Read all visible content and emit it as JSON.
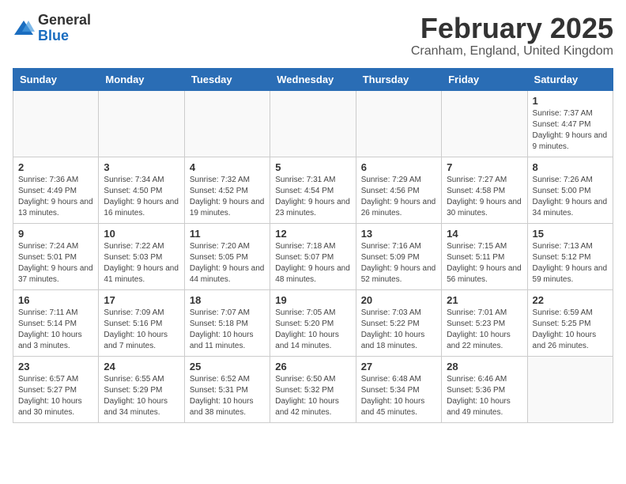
{
  "header": {
    "logo_general": "General",
    "logo_blue": "Blue",
    "month_title": "February 2025",
    "location": "Cranham, England, United Kingdom"
  },
  "weekdays": [
    "Sunday",
    "Monday",
    "Tuesday",
    "Wednesday",
    "Thursday",
    "Friday",
    "Saturday"
  ],
  "weeks": [
    [
      {
        "day": "",
        "info": ""
      },
      {
        "day": "",
        "info": ""
      },
      {
        "day": "",
        "info": ""
      },
      {
        "day": "",
        "info": ""
      },
      {
        "day": "",
        "info": ""
      },
      {
        "day": "",
        "info": ""
      },
      {
        "day": "1",
        "info": "Sunrise: 7:37 AM\nSunset: 4:47 PM\nDaylight: 9 hours\nand 9 minutes."
      }
    ],
    [
      {
        "day": "2",
        "info": "Sunrise: 7:36 AM\nSunset: 4:49 PM\nDaylight: 9 hours\nand 13 minutes."
      },
      {
        "day": "3",
        "info": "Sunrise: 7:34 AM\nSunset: 4:50 PM\nDaylight: 9 hours\nand 16 minutes."
      },
      {
        "day": "4",
        "info": "Sunrise: 7:32 AM\nSunset: 4:52 PM\nDaylight: 9 hours\nand 19 minutes."
      },
      {
        "day": "5",
        "info": "Sunrise: 7:31 AM\nSunset: 4:54 PM\nDaylight: 9 hours\nand 23 minutes."
      },
      {
        "day": "6",
        "info": "Sunrise: 7:29 AM\nSunset: 4:56 PM\nDaylight: 9 hours\nand 26 minutes."
      },
      {
        "day": "7",
        "info": "Sunrise: 7:27 AM\nSunset: 4:58 PM\nDaylight: 9 hours\nand 30 minutes."
      },
      {
        "day": "8",
        "info": "Sunrise: 7:26 AM\nSunset: 5:00 PM\nDaylight: 9 hours\nand 34 minutes."
      }
    ],
    [
      {
        "day": "9",
        "info": "Sunrise: 7:24 AM\nSunset: 5:01 PM\nDaylight: 9 hours\nand 37 minutes."
      },
      {
        "day": "10",
        "info": "Sunrise: 7:22 AM\nSunset: 5:03 PM\nDaylight: 9 hours\nand 41 minutes."
      },
      {
        "day": "11",
        "info": "Sunrise: 7:20 AM\nSunset: 5:05 PM\nDaylight: 9 hours\nand 44 minutes."
      },
      {
        "day": "12",
        "info": "Sunrise: 7:18 AM\nSunset: 5:07 PM\nDaylight: 9 hours\nand 48 minutes."
      },
      {
        "day": "13",
        "info": "Sunrise: 7:16 AM\nSunset: 5:09 PM\nDaylight: 9 hours\nand 52 minutes."
      },
      {
        "day": "14",
        "info": "Sunrise: 7:15 AM\nSunset: 5:11 PM\nDaylight: 9 hours\nand 56 minutes."
      },
      {
        "day": "15",
        "info": "Sunrise: 7:13 AM\nSunset: 5:12 PM\nDaylight: 9 hours\nand 59 minutes."
      }
    ],
    [
      {
        "day": "16",
        "info": "Sunrise: 7:11 AM\nSunset: 5:14 PM\nDaylight: 10 hours\nand 3 minutes."
      },
      {
        "day": "17",
        "info": "Sunrise: 7:09 AM\nSunset: 5:16 PM\nDaylight: 10 hours\nand 7 minutes."
      },
      {
        "day": "18",
        "info": "Sunrise: 7:07 AM\nSunset: 5:18 PM\nDaylight: 10 hours\nand 11 minutes."
      },
      {
        "day": "19",
        "info": "Sunrise: 7:05 AM\nSunset: 5:20 PM\nDaylight: 10 hours\nand 14 minutes."
      },
      {
        "day": "20",
        "info": "Sunrise: 7:03 AM\nSunset: 5:22 PM\nDaylight: 10 hours\nand 18 minutes."
      },
      {
        "day": "21",
        "info": "Sunrise: 7:01 AM\nSunset: 5:23 PM\nDaylight: 10 hours\nand 22 minutes."
      },
      {
        "day": "22",
        "info": "Sunrise: 6:59 AM\nSunset: 5:25 PM\nDaylight: 10 hours\nand 26 minutes."
      }
    ],
    [
      {
        "day": "23",
        "info": "Sunrise: 6:57 AM\nSunset: 5:27 PM\nDaylight: 10 hours\nand 30 minutes."
      },
      {
        "day": "24",
        "info": "Sunrise: 6:55 AM\nSunset: 5:29 PM\nDaylight: 10 hours\nand 34 minutes."
      },
      {
        "day": "25",
        "info": "Sunrise: 6:52 AM\nSunset: 5:31 PM\nDaylight: 10 hours\nand 38 minutes."
      },
      {
        "day": "26",
        "info": "Sunrise: 6:50 AM\nSunset: 5:32 PM\nDaylight: 10 hours\nand 42 minutes."
      },
      {
        "day": "27",
        "info": "Sunrise: 6:48 AM\nSunset: 5:34 PM\nDaylight: 10 hours\nand 45 minutes."
      },
      {
        "day": "28",
        "info": "Sunrise: 6:46 AM\nSunset: 5:36 PM\nDaylight: 10 hours\nand 49 minutes."
      },
      {
        "day": "",
        "info": ""
      }
    ]
  ]
}
